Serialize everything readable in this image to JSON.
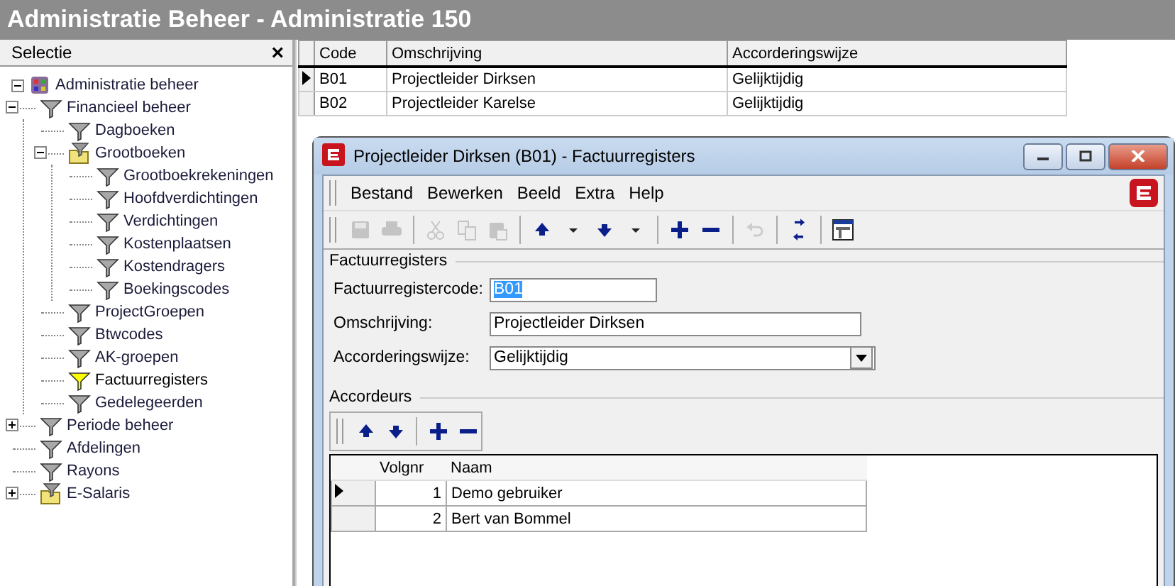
{
  "window": {
    "title": "Administratie Beheer - Administratie 150"
  },
  "sidebar": {
    "title": "Selectie",
    "close": "×",
    "tree": [
      {
        "label": "Administratie beheer",
        "kind": "root",
        "expanded": true,
        "selected": false,
        "children": [
          {
            "label": "Financieel beheer",
            "kind": "filter",
            "expanded": true,
            "selected": false,
            "children": [
              {
                "label": "Dagboeken",
                "kind": "filter",
                "selected": false
              },
              {
                "label": "Grootboeken",
                "kind": "folder",
                "expanded": true,
                "selected": false,
                "children": [
                  {
                    "label": "Grootboekrekeningen",
                    "kind": "filter",
                    "selected": false
                  },
                  {
                    "label": "Hoofdverdichtingen",
                    "kind": "filter",
                    "selected": false
                  },
                  {
                    "label": "Verdichtingen",
                    "kind": "filter",
                    "selected": false
                  },
                  {
                    "label": "Kostenplaatsen",
                    "kind": "filter",
                    "selected": false
                  },
                  {
                    "label": "Kostendragers",
                    "kind": "filter",
                    "selected": false
                  },
                  {
                    "label": "Boekingscodes",
                    "kind": "filter",
                    "selected": false
                  }
                ]
              },
              {
                "label": "ProjectGroepen",
                "kind": "filter",
                "selected": false
              },
              {
                "label": "Btwcodes",
                "kind": "filter",
                "selected": false
              },
              {
                "label": "AK-groepen",
                "kind": "filter",
                "selected": false
              },
              {
                "label": "Factuurregisters",
                "kind": "filter",
                "selected": true
              },
              {
                "label": "Gedelegeerden",
                "kind": "filter",
                "selected": false
              }
            ]
          },
          {
            "label": "Periode beheer",
            "kind": "filter",
            "expanded": false,
            "selected": false
          },
          {
            "label": "Afdelingen",
            "kind": "filter",
            "selected": false
          },
          {
            "label": "Rayons",
            "kind": "filter",
            "selected": false
          },
          {
            "label": "E-Salaris",
            "kind": "folder",
            "expanded": false,
            "selected": false
          }
        ]
      }
    ]
  },
  "table": {
    "columns": [
      "Code",
      "Omschrijving",
      "Accorderingswijze"
    ],
    "rows": [
      {
        "selected": true,
        "cells": [
          "B01",
          "Projectleider Dirksen",
          "Gelijktijdig"
        ]
      },
      {
        "selected": false,
        "cells": [
          "B02",
          "Projectleider Karelse",
          "Gelijktijdig"
        ]
      }
    ]
  },
  "dialog": {
    "title": "Projectleider Dirksen (B01) - Factuurregisters",
    "menu": [
      "Bestand",
      "Bewerken",
      "Beeld",
      "Extra",
      "Help"
    ],
    "toolbar": [
      {
        "kind": "save",
        "disabled": true
      },
      {
        "kind": "print",
        "disabled": true
      },
      {
        "kind": "sep"
      },
      {
        "kind": "cut",
        "disabled": true
      },
      {
        "kind": "copy",
        "disabled": true
      },
      {
        "kind": "paste",
        "disabled": true
      },
      {
        "kind": "sep"
      },
      {
        "kind": "up",
        "disabled": false
      },
      {
        "kind": "caret",
        "disabled": false
      },
      {
        "kind": "down",
        "disabled": false
      },
      {
        "kind": "caret",
        "disabled": false
      },
      {
        "kind": "sep"
      },
      {
        "kind": "add",
        "disabled": false
      },
      {
        "kind": "remove",
        "disabled": false
      },
      {
        "kind": "sep"
      },
      {
        "kind": "undo",
        "disabled": true
      },
      {
        "kind": "sep"
      },
      {
        "kind": "refresh",
        "disabled": false
      },
      {
        "kind": "sep"
      },
      {
        "kind": "window",
        "disabled": false
      }
    ],
    "group": "Factuurregisters",
    "fields": [
      {
        "label": "Factuurregistercode:",
        "value": "B01",
        "kind": "text",
        "selected": true
      },
      {
        "label": "Omschrijving:",
        "value": "Projectleider Dirksen",
        "kind": "text",
        "selected": false
      },
      {
        "label": "Accorderingswijze:",
        "value": "Gelijktijdig",
        "kind": "select",
        "selected": false
      }
    ],
    "subgroup": "Accordeurs",
    "subtoolbar": [
      {
        "kind": "up",
        "disabled": false
      },
      {
        "kind": "down",
        "disabled": false
      },
      {
        "kind": "sep"
      },
      {
        "kind": "add",
        "disabled": false
      },
      {
        "kind": "remove",
        "disabled": false
      }
    ],
    "subtable": {
      "columns": [
        "Volgnr",
        "Naam"
      ],
      "rows": [
        {
          "selected": true,
          "cells": [
            "1",
            "Demo gebruiker"
          ]
        },
        {
          "selected": false,
          "cells": [
            "2",
            "Bert van Bommel"
          ]
        }
      ]
    }
  }
}
